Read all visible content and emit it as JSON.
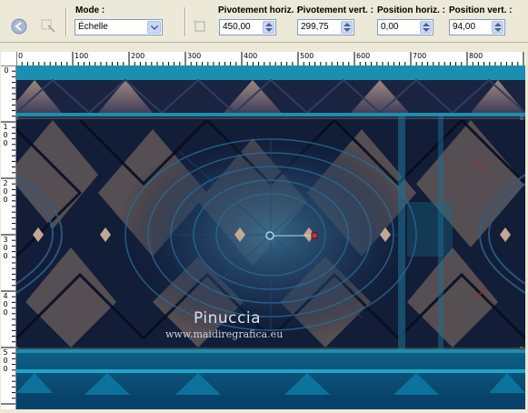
{
  "toolbar": {
    "mode_label": "Mode :",
    "mode_value": "Échelle",
    "pivot_h_label": "Pivotement horiz. :",
    "pivot_h_value": "450,00",
    "pivot_v_label": "Pivotement vert. :",
    "pivot_v_value": "299,75",
    "pos_h_label": "Position horiz. :",
    "pos_h_value": "0,00",
    "pos_v_label": "Position vert. :",
    "pos_v_value": "94,00"
  },
  "ruler_top": [
    "0",
    "100",
    "200",
    "300",
    "400",
    "500",
    "600",
    "700",
    "800"
  ],
  "ruler_left": [
    "0",
    "100",
    "200",
    "300",
    "400",
    "500"
  ],
  "watermark": {
    "title": "Pinuccia",
    "url": "www.maidiregrafica.eu"
  },
  "colors": {
    "teal_band": "#1b8fb0",
    "dark_bg": "#0d1a33",
    "tan": "#9c8677"
  }
}
